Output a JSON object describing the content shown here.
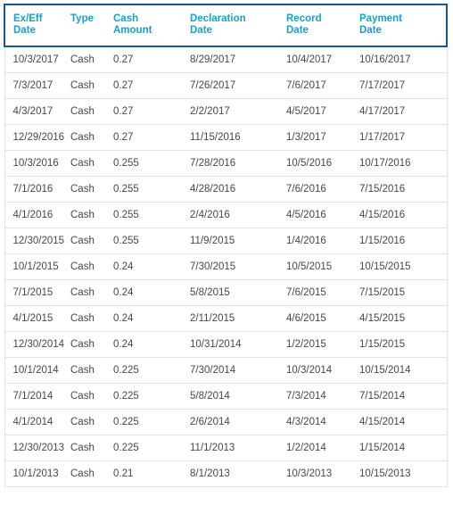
{
  "table": {
    "name": "dividend-history-table",
    "colors": {
      "header_text": "#18a0c8",
      "header_border": "#17578f",
      "row_border": "#e2e2e2",
      "cell_text": "#474747",
      "background": "#ffffff"
    },
    "columns": [
      {
        "key": "ex_eff_date",
        "label": "Ex/Eff\nDate"
      },
      {
        "key": "type",
        "label": "Type"
      },
      {
        "key": "cash_amount",
        "label": "Cash\nAmount"
      },
      {
        "key": "declaration_date",
        "label": "Declaration\nDate"
      },
      {
        "key": "record_date",
        "label": "Record\nDate"
      },
      {
        "key": "payment_date",
        "label": "Payment\nDate"
      }
    ],
    "rows": [
      {
        "ex_eff_date": "10/3/2017",
        "type": "Cash",
        "cash_amount": "0.27",
        "declaration_date": "8/29/2017",
        "record_date": "10/4/2017",
        "payment_date": "10/16/2017"
      },
      {
        "ex_eff_date": "7/3/2017",
        "type": "Cash",
        "cash_amount": "0.27",
        "declaration_date": "7/26/2017",
        "record_date": "7/6/2017",
        "payment_date": "7/17/2017"
      },
      {
        "ex_eff_date": "4/3/2017",
        "type": "Cash",
        "cash_amount": "0.27",
        "declaration_date": "2/2/2017",
        "record_date": "4/5/2017",
        "payment_date": "4/17/2017"
      },
      {
        "ex_eff_date": "12/29/2016",
        "type": "Cash",
        "cash_amount": "0.27",
        "declaration_date": "11/15/2016",
        "record_date": "1/3/2017",
        "payment_date": "1/17/2017"
      },
      {
        "ex_eff_date": "10/3/2016",
        "type": "Cash",
        "cash_amount": "0.255",
        "declaration_date": "7/28/2016",
        "record_date": "10/5/2016",
        "payment_date": "10/17/2016"
      },
      {
        "ex_eff_date": "7/1/2016",
        "type": "Cash",
        "cash_amount": "0.255",
        "declaration_date": "4/28/2016",
        "record_date": "7/6/2016",
        "payment_date": "7/15/2016"
      },
      {
        "ex_eff_date": "4/1/2016",
        "type": "Cash",
        "cash_amount": "0.255",
        "declaration_date": "2/4/2016",
        "record_date": "4/5/2016",
        "payment_date": "4/15/2016"
      },
      {
        "ex_eff_date": "12/30/2015",
        "type": "Cash",
        "cash_amount": "0.255",
        "declaration_date": "11/9/2015",
        "record_date": "1/4/2016",
        "payment_date": "1/15/2016"
      },
      {
        "ex_eff_date": "10/1/2015",
        "type": "Cash",
        "cash_amount": "0.24",
        "declaration_date": "7/30/2015",
        "record_date": "10/5/2015",
        "payment_date": "10/15/2015"
      },
      {
        "ex_eff_date": "7/1/2015",
        "type": "Cash",
        "cash_amount": "0.24",
        "declaration_date": "5/8/2015",
        "record_date": "7/6/2015",
        "payment_date": "7/15/2015"
      },
      {
        "ex_eff_date": "4/1/2015",
        "type": "Cash",
        "cash_amount": "0.24",
        "declaration_date": "2/11/2015",
        "record_date": "4/6/2015",
        "payment_date": "4/15/2015"
      },
      {
        "ex_eff_date": "12/30/2014",
        "type": "Cash",
        "cash_amount": "0.24",
        "declaration_date": "10/31/2014",
        "record_date": "1/2/2015",
        "payment_date": "1/15/2015"
      },
      {
        "ex_eff_date": "10/1/2014",
        "type": "Cash",
        "cash_amount": "0.225",
        "declaration_date": "7/30/2014",
        "record_date": "10/3/2014",
        "payment_date": "10/15/2014"
      },
      {
        "ex_eff_date": "7/1/2014",
        "type": "Cash",
        "cash_amount": "0.225",
        "declaration_date": "5/8/2014",
        "record_date": "7/3/2014",
        "payment_date": "7/15/2014"
      },
      {
        "ex_eff_date": "4/1/2014",
        "type": "Cash",
        "cash_amount": "0.225",
        "declaration_date": "2/6/2014",
        "record_date": "4/3/2014",
        "payment_date": "4/15/2014"
      },
      {
        "ex_eff_date": "12/30/2013",
        "type": "Cash",
        "cash_amount": "0.225",
        "declaration_date": "11/1/2013",
        "record_date": "1/2/2014",
        "payment_date": "1/15/2014"
      },
      {
        "ex_eff_date": "10/1/2013",
        "type": "Cash",
        "cash_amount": "0.21",
        "declaration_date": "8/1/2013",
        "record_date": "10/3/2013",
        "payment_date": "10/15/2013"
      }
    ]
  }
}
